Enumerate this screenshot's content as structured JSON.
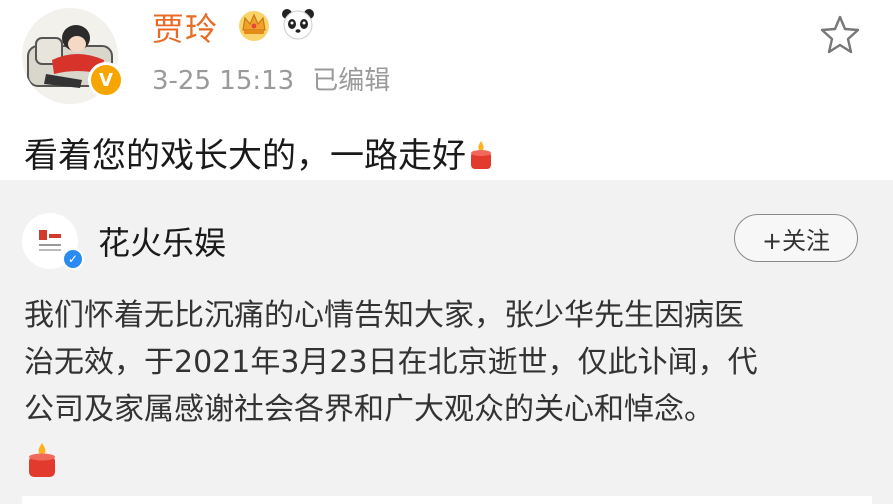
{
  "post": {
    "username": "贾玲",
    "timestamp": "3-25 15:13",
    "edited": "已编辑",
    "text": "看着您的戏长大的，一路走好"
  },
  "repost": {
    "account_name": "花火乐娱",
    "follow_label": "+关注",
    "lines": [
      "我们怀着无比沉痛的心情告知大家，张少华先生因病医",
      "治无效，于2021年3月23日在北京逝世，仅此讣闻，代",
      "公司及家属感谢社会各界和广大观众的关心和悼念。"
    ]
  },
  "icons": {
    "crown": "crown-icon",
    "panda": "panda-icon",
    "star": "star-icon",
    "candle": "candle-icon",
    "verified": "verified-icon",
    "vip": "vip-badge-icon"
  },
  "colors": {
    "username": "#e86a24",
    "meta": "#9a9a9a",
    "repost_bg": "#f2f2f2",
    "verified": "#2a8cf0",
    "vip": "#f7a500"
  }
}
